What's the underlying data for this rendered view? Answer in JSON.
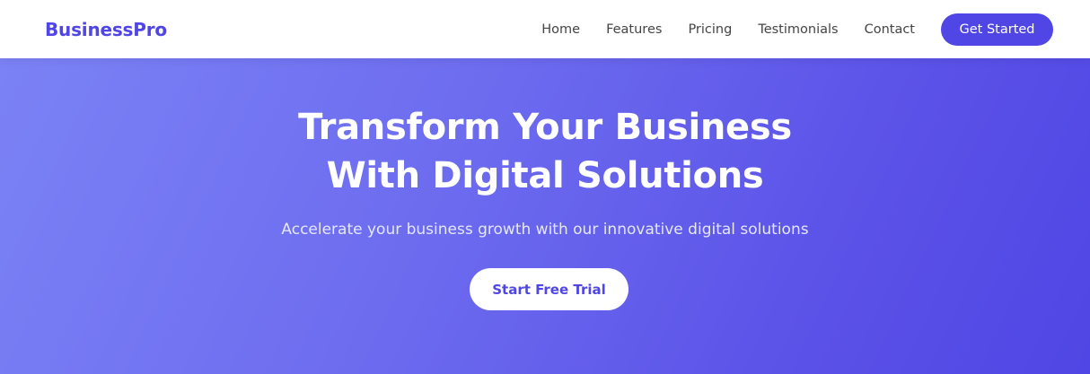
{
  "navbar": {
    "brand": "BusinessPro",
    "links": [
      {
        "label": "Home"
      },
      {
        "label": "Features"
      },
      {
        "label": "Pricing"
      },
      {
        "label": "Testimonials"
      },
      {
        "label": "Contact"
      }
    ],
    "cta_label": "Get Started"
  },
  "hero": {
    "title_line1": "Transform Your Business",
    "title_line2": "With Digital Solutions",
    "subtitle": "Accelerate your business growth with our innovative digital solutions",
    "cta_label": "Start Free Trial"
  },
  "colors": {
    "accent": "#4f46e5",
    "hero_gradient_start": "#7b82f5",
    "hero_gradient_end": "#4f46e5"
  }
}
